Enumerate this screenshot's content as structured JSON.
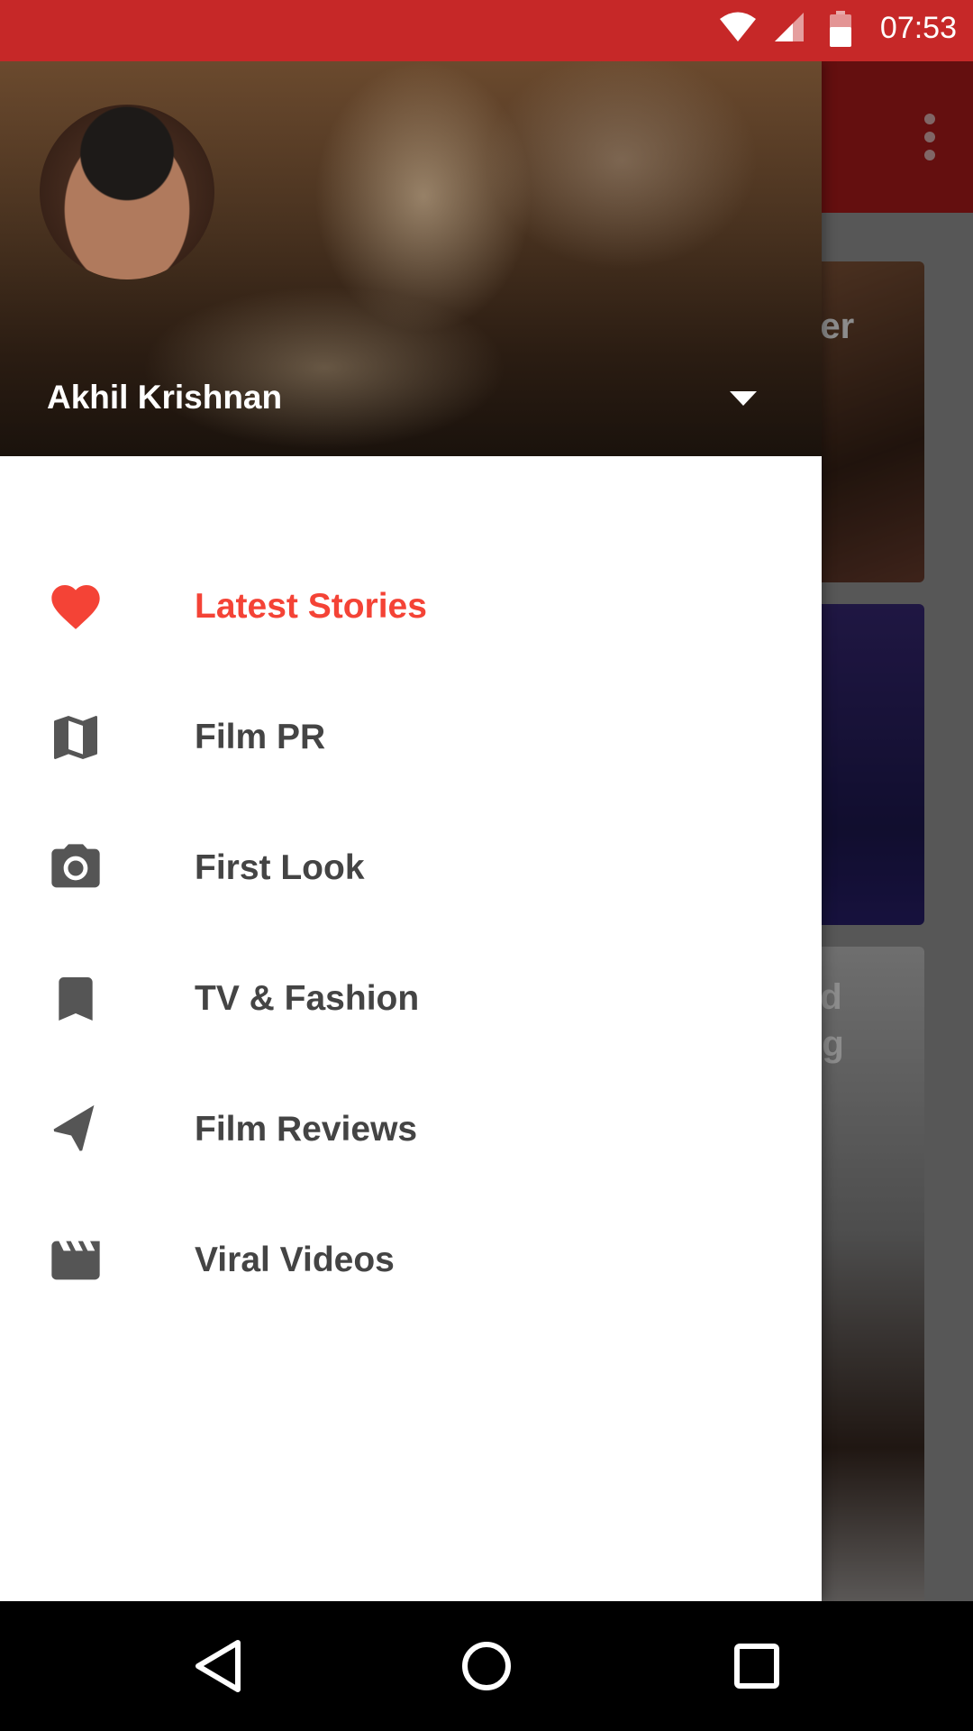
{
  "status_bar": {
    "time": "07:53",
    "icons": [
      "wifi-icon",
      "signal-icon",
      "battery-icon"
    ],
    "color": "#c62828"
  },
  "app": {
    "toolbar_color": "#b71c1c",
    "menu_icon": "overflow-icon",
    "cards": [
      {
        "text": "ger"
      },
      {
        "text": ""
      },
      {
        "text": "ed\nng"
      }
    ]
  },
  "drawer": {
    "account": {
      "name": "Akhil Krishnan",
      "toggle_icon": "dropdown-arrow-icon"
    },
    "accent_color": "#f44336",
    "items": [
      {
        "label": "Latest Stories",
        "icon": "heart-icon",
        "active": true
      },
      {
        "label": "Film PR",
        "icon": "map-icon",
        "active": false
      },
      {
        "label": "First Look",
        "icon": "camera-icon",
        "active": false
      },
      {
        "label": "TV & Fashion",
        "icon": "bookmark-icon",
        "active": false
      },
      {
        "label": "Film Reviews",
        "icon": "navigation-icon",
        "active": false
      },
      {
        "label": "Viral Videos",
        "icon": "movie-icon",
        "active": false
      }
    ]
  },
  "nav_bar": {
    "buttons": [
      "back-icon",
      "home-icon",
      "recent-apps-icon"
    ]
  }
}
